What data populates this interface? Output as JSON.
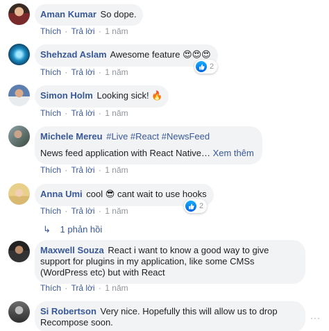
{
  "actions": {
    "like": "Thích",
    "reply": "Trả lời",
    "separator": "·",
    "time": "1 năm"
  },
  "comments": [
    {
      "author": "Aman Kumar",
      "text": "So dope."
    },
    {
      "author": "Shehzad Aslam",
      "text": "Awesome feature",
      "emoji": "😍😍😍",
      "reaction_count": "2"
    },
    {
      "author": "Simon Holm",
      "text": "Looking sick!",
      "emoji": "🔥"
    },
    {
      "author": "Michele Mereu",
      "tags": [
        "#Live",
        "#React",
        "#NewsFeed"
      ],
      "text": "News feed application with React Native…",
      "see_more": "Xem thêm"
    },
    {
      "author": "Anna Umi",
      "text_before": "cool",
      "emoji": "😎",
      "text_after": "cant wait to use hooks",
      "reaction_count": "2"
    },
    {
      "author": "Maxwell Souza",
      "text": "React i want to know a good way to give support for plugins in my application, like some CMSs (WordPress etc) but with React"
    },
    {
      "author": "Si Robertson",
      "text": "Very nice. Hopefully this will allow us to drop Recompose soon."
    }
  ],
  "replies_link": {
    "arrow": "↳",
    "label": "1 phản hồi"
  },
  "more_dots": "···",
  "colors": {
    "link": "#385898",
    "bubble": "#f2f3f5",
    "meta": "#90949c",
    "like_blue": "#1877f2"
  }
}
